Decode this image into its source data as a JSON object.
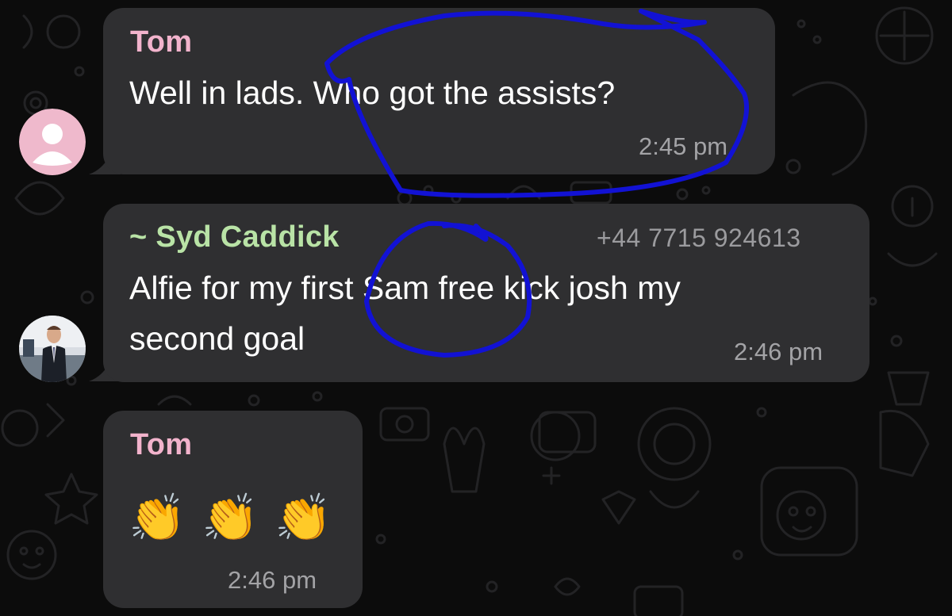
{
  "colors": {
    "background": "#0c0c0c",
    "bubble": "#2f2f31",
    "tom_name": "#f2b3cc",
    "syd_name": "#b9e3a6",
    "timestamp": "#a3a3a6",
    "annotation": "#1212d4"
  },
  "messages": [
    {
      "sender": "Tom",
      "text": "Well in lads. Who got the assists?",
      "time": "2:45 pm",
      "avatar_icon": "default-user-icon"
    },
    {
      "sender": "~ Syd Caddick",
      "phone": "+44 7715 924613",
      "text_line1": "Alfie for my first Sam free kick josh my",
      "text_line2": "second goal",
      "time": "2:46 pm",
      "avatar_icon": "profile-photo"
    },
    {
      "sender": "Tom",
      "emojis": [
        "👏",
        "👏",
        "👏"
      ],
      "time": "2:46 pm"
    }
  ]
}
